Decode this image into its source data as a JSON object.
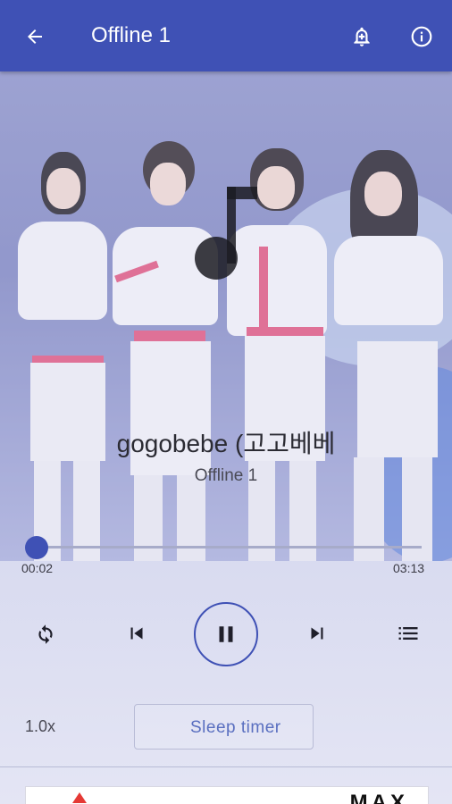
{
  "header": {
    "title": "Offline 1",
    "back_icon": "arrow-back-icon",
    "bell_icon": "notification-bell-icon",
    "info_icon": "info-icon"
  },
  "player": {
    "song_title": "gogobebe (고고베베",
    "subtitle": "Offline 1",
    "elapsed": "00:02",
    "duration": "03:13",
    "progress_fraction": 0.01,
    "speed": "1.0x",
    "sleep_timer_label": "Sleep timer"
  },
  "controls": {
    "repeat_icon": "repeat-icon",
    "prev_icon": "skip-previous-icon",
    "play_state_icon": "pause-icon",
    "next_icon": "skip-next-icon",
    "queue_icon": "queue-list-icon"
  },
  "ad": {
    "text": "MAX"
  },
  "colors": {
    "accent": "#3f51b5",
    "background": "#d3d6ee"
  }
}
